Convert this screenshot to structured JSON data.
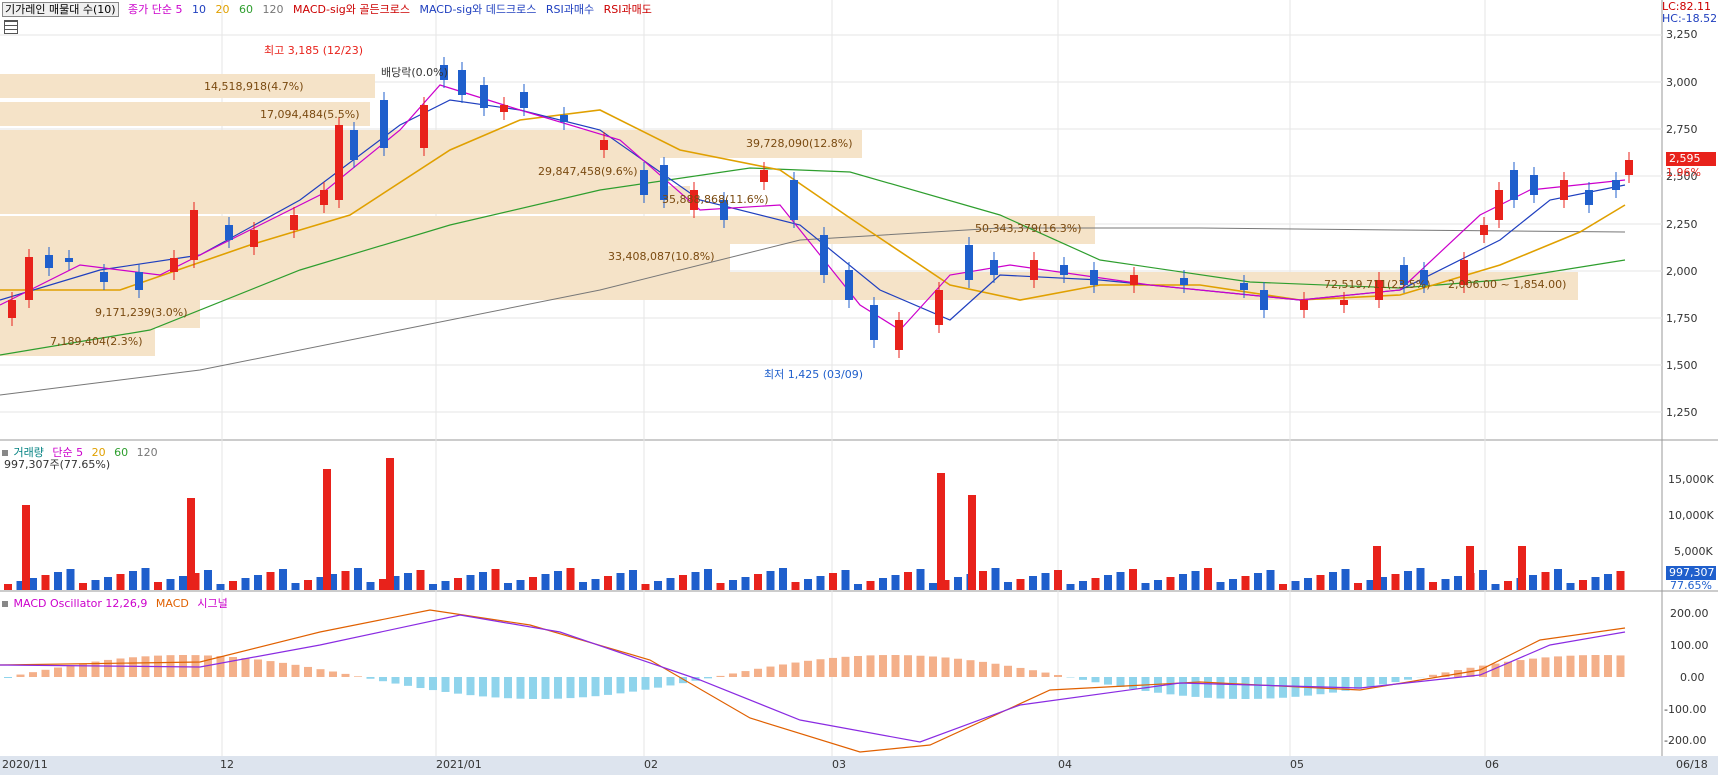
{
  "legend": {
    "title": "기가레인 매물대 수(10)",
    "items": [
      {
        "label": "종가 단순 5",
        "color": "#cc00cc"
      },
      {
        "label": "10",
        "color": "#1f3fbf"
      },
      {
        "label": "20",
        "color": "#e0a000"
      },
      {
        "label": "60",
        "color": "#2e9e2e"
      },
      {
        "label": "120",
        "color": "#777777"
      },
      {
        "label": "MACD-sig와 골든크로스",
        "color": "#cc0000"
      },
      {
        "label": "MACD-sig와 데드크로스",
        "color": "#1f3fbf"
      },
      {
        "label": "RSI과매수",
        "color": "#1f3fbf"
      },
      {
        "label": "RSI과매도",
        "color": "#cc0000"
      }
    ],
    "lc": "LC:82.11",
    "hc": "HC:-18.52"
  },
  "price_axis": [
    "3,250",
    "3,000",
    "2,750",
    "2,500",
    "2,250",
    "2,000",
    "1,750",
    "1,500",
    "1,250"
  ],
  "current_price": {
    "price": "2,595",
    "change": "1.96%"
  },
  "annotations": {
    "high": "최고 3,185 (12/23)",
    "low": "최저 1,425 (03/09)",
    "dividend": "배당락(0.0%)"
  },
  "volume_profile_labels": [
    "14,518,918(4.7%)",
    "17,094,484(5.5%)",
    "39,728,090(12.8%)",
    "29,847,458(9.6%)",
    "35,888,868(11.6%)",
    "33,408,087(10.8%)",
    "50,343,379(16.3%)",
    "72,519,711(23.5%)",
    "9,171,239(3.0%)",
    "7,189,404(2.3%)"
  ],
  "range_annotation": "2,006.00 ~ 1,854.00)",
  "volume_panel": {
    "legend": [
      {
        "label": "거래량",
        "color": "#008080"
      },
      {
        "label": "단순 5",
        "color": "#cc00cc"
      },
      {
        "label": "20",
        "color": "#e0a000"
      },
      {
        "label": "60",
        "color": "#2e9e2e"
      },
      {
        "label": "120",
        "color": "#777777"
      }
    ],
    "info": "997,307주(77.65%)",
    "axis": [
      "15,000K",
      "10,000K",
      "5,000K"
    ],
    "current": {
      "value": "997,307",
      "pct": "77.65%"
    }
  },
  "macd_panel": {
    "legend": [
      {
        "label": "MACD Oscillator 12,26,9",
        "color": "#cc00cc"
      },
      {
        "label": "MACD",
        "color": "#e06000"
      },
      {
        "label": "시그널",
        "color": "#cc00cc"
      }
    ],
    "axis": [
      "200.00",
      "100.00",
      "0.00",
      "-100.00",
      "-200.00"
    ]
  },
  "x_axis": [
    "2020/11",
    "12",
    "2021/01",
    "02",
    "03",
    "04",
    "05",
    "06",
    "06/18"
  ],
  "colors": {
    "up": "#e8221b",
    "down": "#1f5fcc",
    "profile": "#f5e3c8"
  }
}
